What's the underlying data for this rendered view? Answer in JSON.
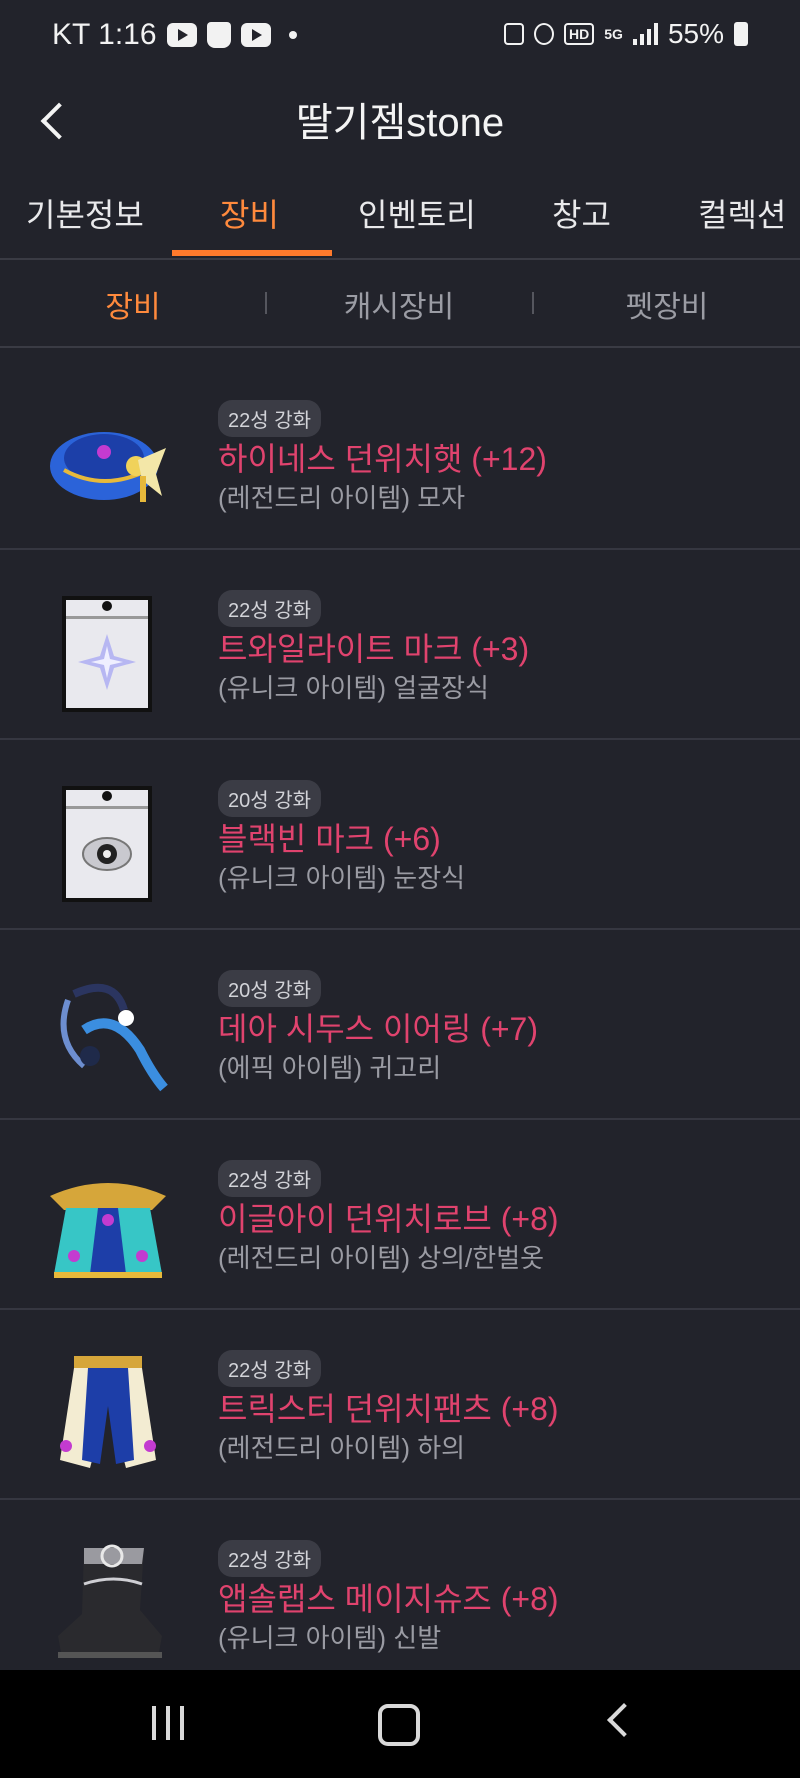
{
  "status_bar": {
    "carrier_time": "KT 1:16",
    "network_hd": "HD",
    "network_5g": "5G",
    "battery": "55%"
  },
  "header": {
    "title": "딸기젬stone"
  },
  "tabs": [
    {
      "label": "기본정보"
    },
    {
      "label": "장비"
    },
    {
      "label": "인벤토리"
    },
    {
      "label": "창고"
    },
    {
      "label": "컬렉션"
    }
  ],
  "subtabs": [
    {
      "label": "장비"
    },
    {
      "label": "캐시장비"
    },
    {
      "label": "펫장비"
    }
  ],
  "items": [
    {
      "badge": "22성 강화",
      "name": "하이네스 던위치햇 (+12)",
      "sub": "(레전드리 아이템) 모자",
      "icon": "hat-icon"
    },
    {
      "badge": "22성 강화",
      "name": "트와일라이트 마크 (+3)",
      "sub": "(유니크 아이템) 얼굴장식",
      "icon": "face-accessory-icon"
    },
    {
      "badge": "20성 강화",
      "name": "블랙빈 마크 (+6)",
      "sub": "(유니크 아이템) 눈장식",
      "icon": "eye-accessory-icon"
    },
    {
      "badge": "20성 강화",
      "name": "데아 시두스 이어링 (+7)",
      "sub": "(에픽 아이템) 귀고리",
      "icon": "earring-icon"
    },
    {
      "badge": "22성 강화",
      "name": "이글아이 던위치로브 (+8)",
      "sub": "(레전드리 아이템) 상의/한벌옷",
      "icon": "robe-icon"
    },
    {
      "badge": "22성 강화",
      "name": "트릭스터 던위치팬츠 (+8)",
      "sub": "(레전드리 아이템) 하의",
      "icon": "pants-icon"
    },
    {
      "badge": "22성 강화",
      "name": "앱솔랩스 메이지슈즈 (+8)",
      "sub": "(유니크 아이템) 신발",
      "icon": "shoes-icon"
    }
  ],
  "colors": {
    "accent": "#ff8a3d",
    "item_name": "#e0436e",
    "background": "#22232b"
  }
}
